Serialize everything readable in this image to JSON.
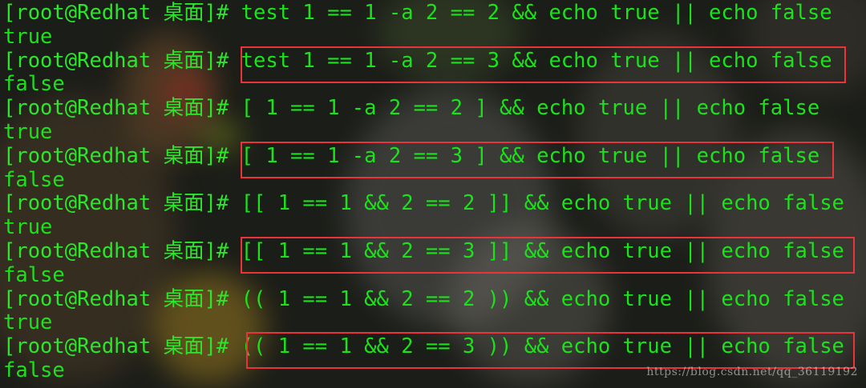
{
  "terminal": {
    "prompt": "[root@Redhat 桌面]# ",
    "lines": [
      {
        "kind": "cmd",
        "text": "test 1 == 1 -a 2 == 2 && echo true || echo false"
      },
      {
        "kind": "out",
        "text": "true"
      },
      {
        "kind": "cmd",
        "text": "test 1 == 1 -a 2 == 3 && echo true || echo false",
        "highlighted": true
      },
      {
        "kind": "out",
        "text": "false"
      },
      {
        "kind": "cmd",
        "text": "[ 1 == 1 -a 2 == 2 ] && echo true || echo false"
      },
      {
        "kind": "out",
        "text": "true"
      },
      {
        "kind": "cmd",
        "text": "[ 1 == 1 -a 2 == 3 ] && echo true || echo false",
        "highlighted": true
      },
      {
        "kind": "out",
        "text": "false"
      },
      {
        "kind": "cmd",
        "text": "[[ 1 == 1 && 2 == 2 ]] && echo true || echo false"
      },
      {
        "kind": "out",
        "text": "true"
      },
      {
        "kind": "cmd",
        "text": "[[ 1 == 1 && 2 == 3 ]] && echo true || echo false",
        "highlighted": true
      },
      {
        "kind": "out",
        "text": "false"
      },
      {
        "kind": "cmd",
        "text": "(( 1 == 1 && 2 == 2 )) && echo true || echo false"
      },
      {
        "kind": "out",
        "text": "true"
      },
      {
        "kind": "cmd",
        "text": "(( 1 == 1 && 2 == 3 )) && echo true || echo false",
        "highlighted": true
      },
      {
        "kind": "out",
        "text": "false"
      }
    ]
  },
  "watermark": "https://blog.csdn.net/qq_36119192",
  "colors": {
    "terminal_text": "#1be21b",
    "highlight_box": "#e8343a",
    "background": "#1b1d18"
  }
}
